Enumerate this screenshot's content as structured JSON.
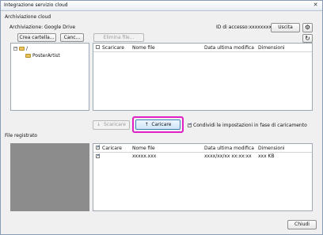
{
  "window": {
    "title": "Integrazione servizio cloud"
  },
  "archive_group": {
    "label": "Archiviazione cloud",
    "service": "Archiviazione: Google Drive",
    "access_id": "ID di accesso:xxxxxxxx",
    "logout_label": "Uscita"
  },
  "toolbar": {
    "create_folder_label": "Crea cartella...",
    "cancel_label": "Canc...",
    "delete_file_label": "Elimina file..."
  },
  "folder_tree": {
    "root_label": "/",
    "child_label": "PosterArtist"
  },
  "cloud_list": {
    "columns": [
      "Scaricare",
      "Nome file",
      "Data ultima modifica",
      "Dimensioni"
    ]
  },
  "transfer": {
    "download_label": "Scaricare",
    "upload_label": "Caricare",
    "share_settings_label": "Condividi le impostazioni in fase di caricamento"
  },
  "registered": {
    "label": "File registrato",
    "columns": [
      "Caricare",
      "Nome file",
      "Data ultima modifica",
      "Dimensioni"
    ],
    "rows": [
      {
        "filename": "xxxxx.xxx",
        "modified": "xxxx/xx/xx  xx:xx:xx",
        "size": "xxx KB"
      }
    ]
  },
  "footer": {
    "close_label": "Chiudi"
  }
}
